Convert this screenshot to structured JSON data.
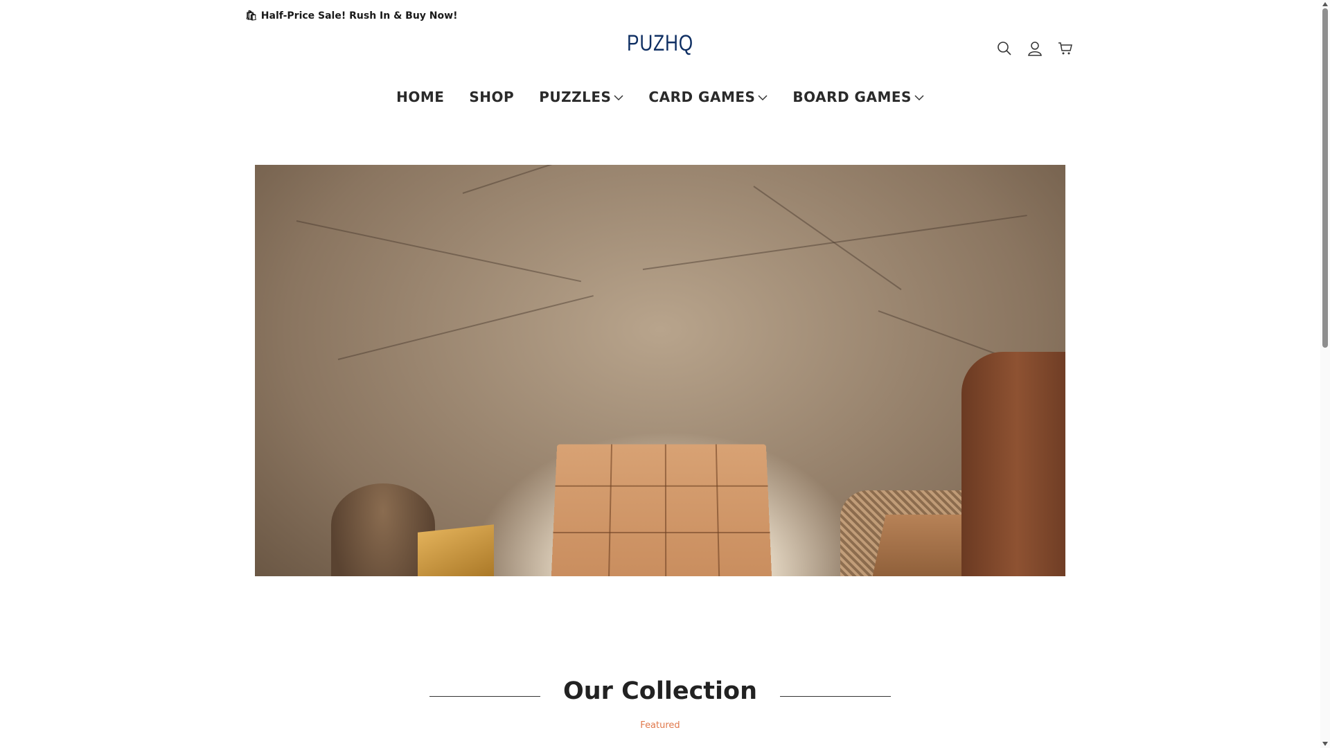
{
  "announcement": {
    "emoji": "🛍",
    "text": "Half-Price Sale! Rush In & Buy Now!"
  },
  "brand": {
    "logo_text": "PUZHQ",
    "color": "#0f2f63"
  },
  "header_icons": [
    "search-icon",
    "account-icon",
    "cart-icon"
  ],
  "nav": {
    "items": [
      {
        "label": "HOME",
        "has_dropdown": false
      },
      {
        "label": "SHOP",
        "has_dropdown": false
      },
      {
        "label": "PUZZLES",
        "has_dropdown": true
      },
      {
        "label": "CARD GAMES",
        "has_dropdown": true
      },
      {
        "label": "BOARD GAMES",
        "has_dropdown": true
      }
    ]
  },
  "collection": {
    "title": "Our Collection",
    "subtitle": "Featured",
    "subtitle_color": "#e0784b"
  }
}
